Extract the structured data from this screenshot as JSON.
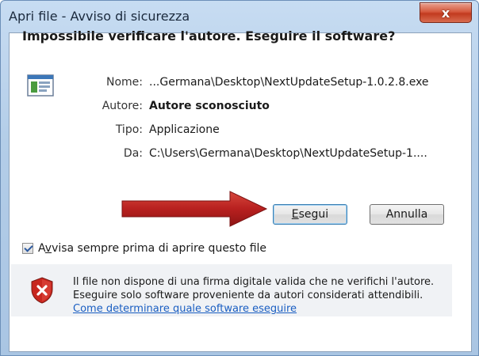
{
  "window": {
    "title": "Apri file - Avviso di sicurezza",
    "close_glyph": "x"
  },
  "dialog": {
    "heading": "Impossibile verificare l'autore. Eseguire il software?",
    "file_icon": "application-window-icon",
    "fields": [
      {
        "label": "Nome:",
        "value": "...Germana\\Desktop\\NextUpdateSetup-1.0.2.8.exe"
      },
      {
        "label": "Autore:",
        "value": "Autore sconosciuto"
      },
      {
        "label": "Tipo:",
        "value": "Applicazione"
      },
      {
        "label": "Da:",
        "value": "C:\\Users\\Germana\\Desktop\\NextUpdateSetup-1...."
      }
    ],
    "run_button": {
      "mnemonic": "E",
      "rest": "segui"
    },
    "cancel_button": "Annulla",
    "checkbox": {
      "checked": true,
      "label_before": "A",
      "mnemonic": "v",
      "label_after": "visa sempre prima di aprire questo file"
    }
  },
  "footer": {
    "warning_icon": "shield-error-icon",
    "line1": "Il file non dispone di una firma digitale valida che ne verifichi l'autore.",
    "line2": "Eseguire solo software proveniente da autori considerati attendibili.",
    "link": "Come determinare quale software eseguire"
  },
  "annotation": {
    "arrow_color": "#b8201f"
  }
}
